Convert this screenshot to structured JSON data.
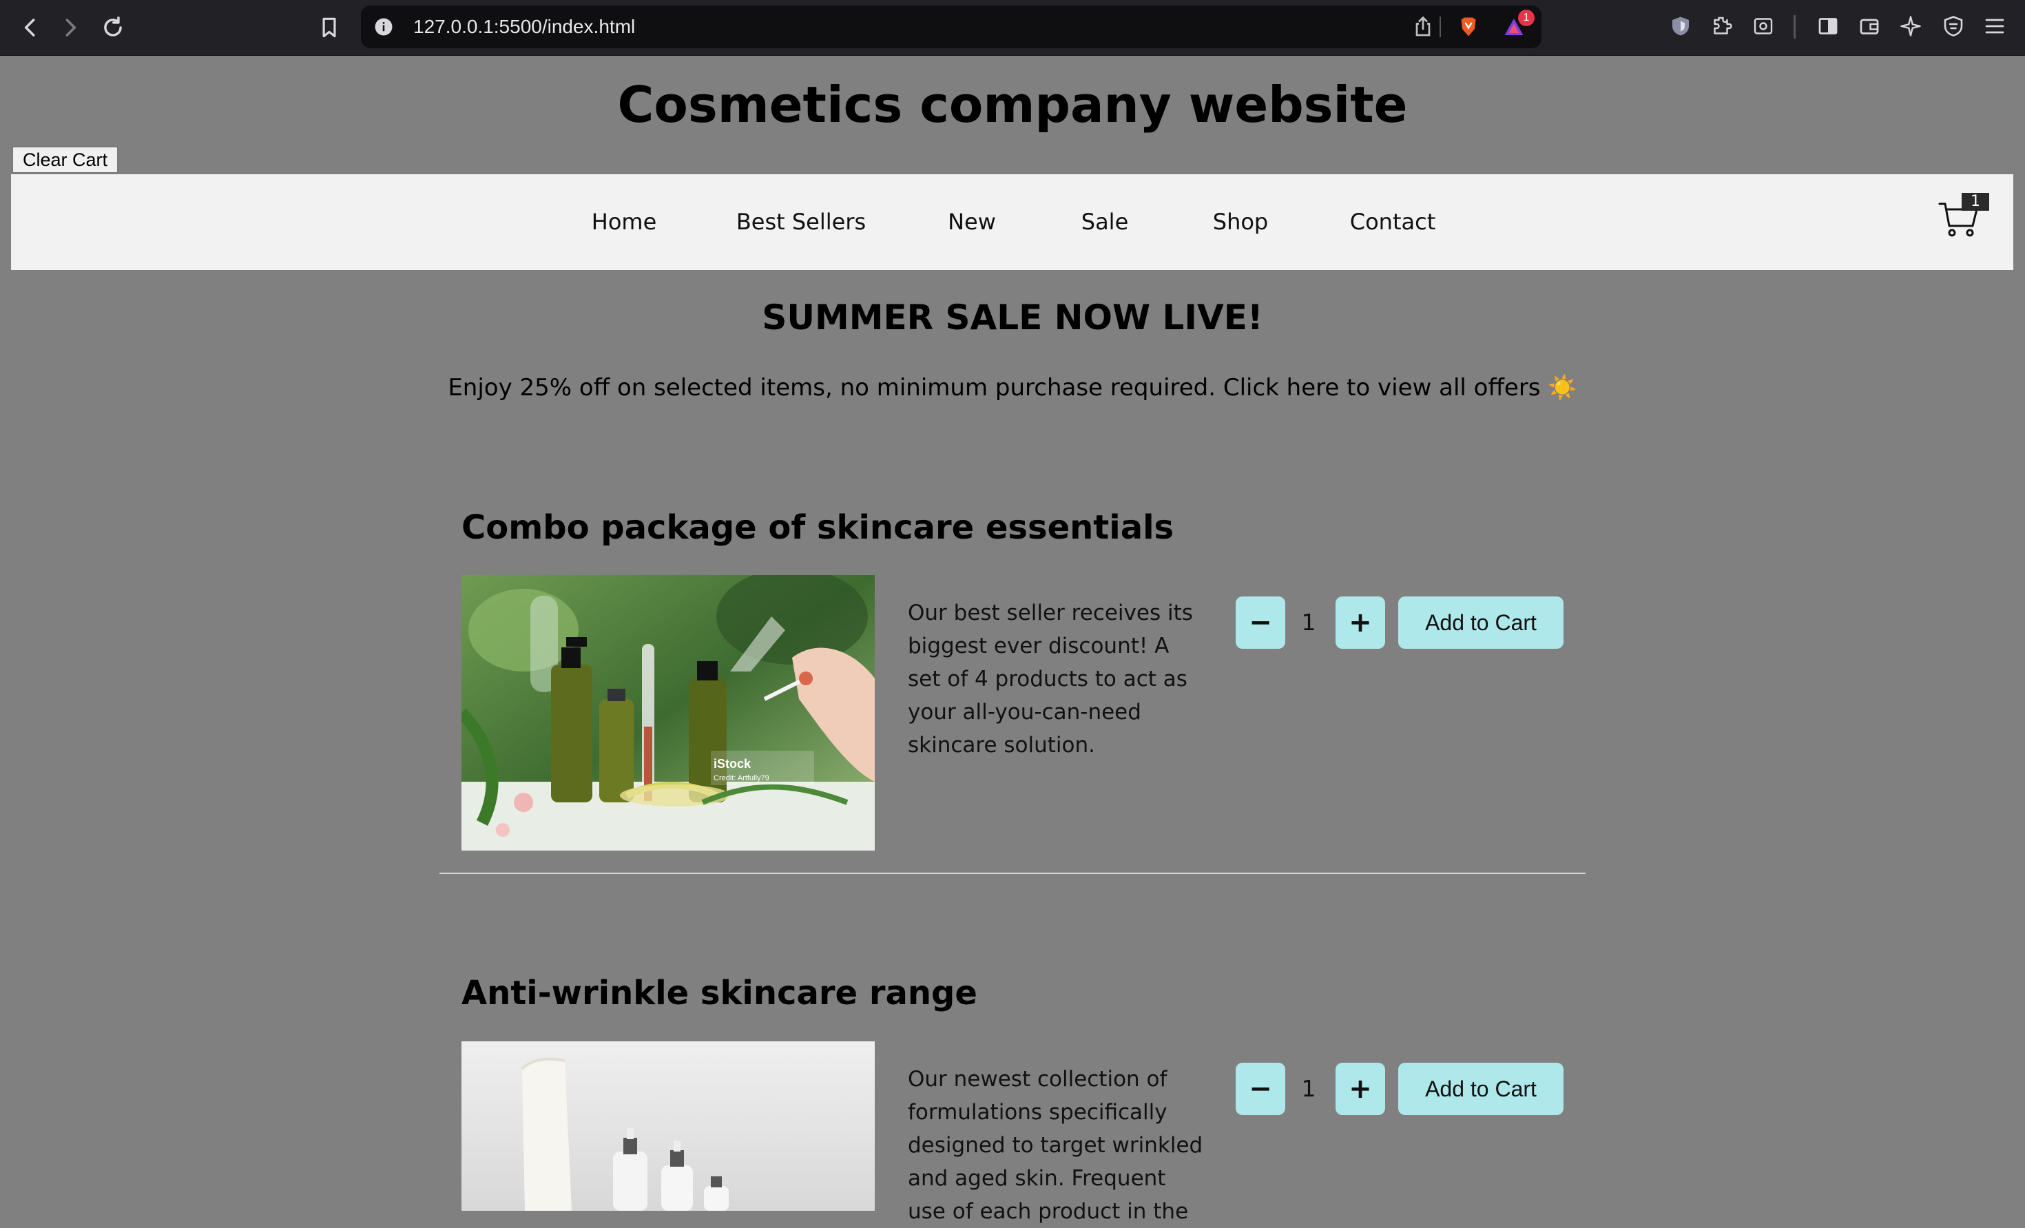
{
  "browser": {
    "url": "127.0.0.1:5500/index.html",
    "notification_count": "1"
  },
  "site": {
    "title": "Cosmetics company website",
    "clear_cart_label": "Clear Cart"
  },
  "nav": {
    "links": [
      "Home",
      "Best Sellers",
      "New",
      "Sale",
      "Shop",
      "Contact"
    ],
    "cart_count": "1"
  },
  "banner": {
    "heading": "SUMMER SALE NOW LIVE!",
    "text": "Enjoy 25% off on selected items, no minimum purchase required. Click here to view all offers ☀️"
  },
  "products": [
    {
      "title": "Combo package of skincare essentials",
      "description": "Our best seller receives its biggest ever discount! A set of 4 products to act as your all-you-can-need skincare solution.",
      "quantity": "1",
      "minus_label": "−",
      "plus_label": "+",
      "add_label": "Add to Cart",
      "watermark": "iStock",
      "credit": "Credit: Artfully79"
    },
    {
      "title": "Anti-wrinkle skincare range",
      "description": "Our newest collection of formulations specifically designed to target wrinkled and aged skin. Frequent use of each product in the",
      "quantity": "1",
      "minus_label": "−",
      "plus_label": "+",
      "add_label": "Add to Cart"
    }
  ]
}
